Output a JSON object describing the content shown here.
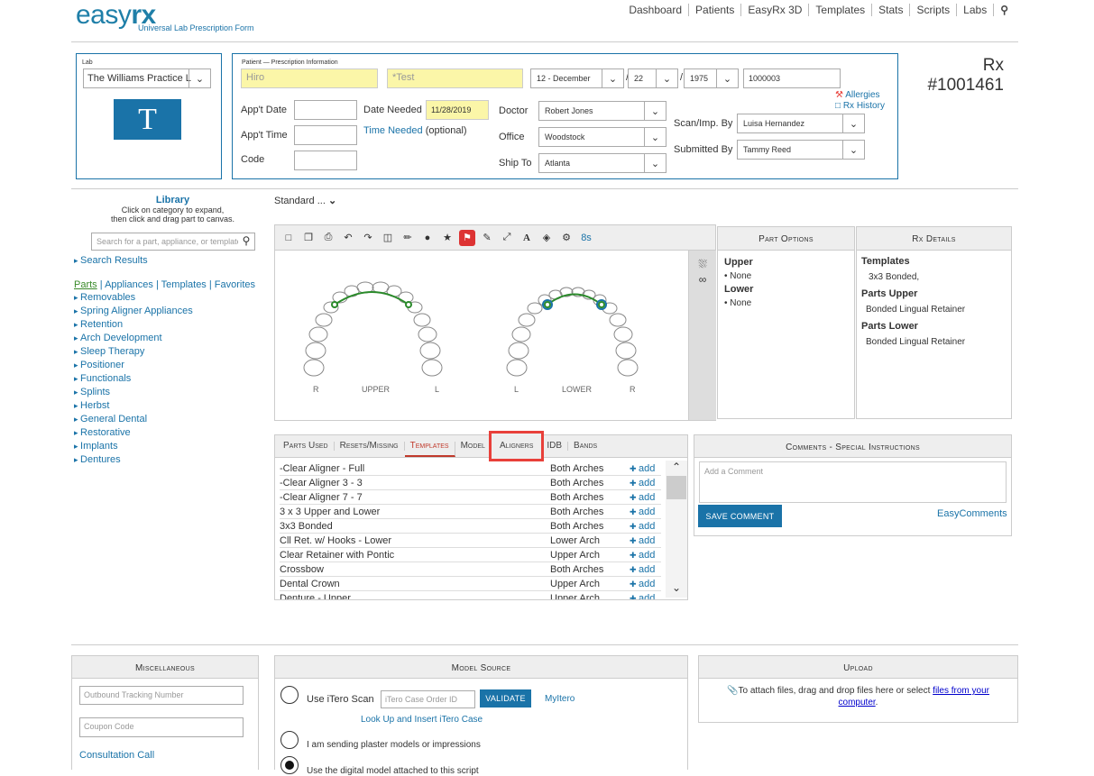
{
  "header": {
    "logo_main": "easyrx",
    "logo_sub": "Universal Lab Prescription Form",
    "nav": [
      "Dashboard",
      "Patients",
      "EasyRx 3D",
      "Templates",
      "Stats",
      "Scripts",
      "Labs"
    ],
    "rx_label": "Rx",
    "rx_number": "#1001461"
  },
  "lab": {
    "label": "Lab",
    "selected": "The Williams Practice L",
    "logo_letter": "T"
  },
  "patient": {
    "section_label": "Patient — Prescription Information",
    "first_name": "Hiro",
    "last_name": "*Test",
    "birth_month": "12 - December",
    "birth_day": "22",
    "birth_year": "1975",
    "patient_id": "1000003",
    "allergies": "Allergies",
    "rx_history": "Rx History",
    "appt_date_label": "App't Date",
    "appt_time_label": "App't Time",
    "code_label": "Code",
    "date_needed_label": "Date Needed",
    "date_needed_value": "11/28/2019",
    "time_needed_label": "Time Needed",
    "time_needed_optional": "(optional)",
    "doctor_label": "Doctor",
    "doctor": "Robert Jones",
    "office_label": "Office",
    "office": "Woodstock",
    "ship_to_label": "Ship To",
    "ship_to": "Atlanta",
    "scan_by_label": "Scan/Imp. By",
    "scan_by": "Luisa Hernandez",
    "submitted_by_label": "Submitted By",
    "submitted_by": "Tammy Reed"
  },
  "library": {
    "title": "Library",
    "hint1": "Click on category to expand,",
    "hint2": "then click and drag part to canvas.",
    "search_placeholder": "Search for a part, appliance, or template",
    "search_results": "Search Results",
    "tabs": [
      "Parts",
      "Appliances",
      "Templates",
      "Favorites"
    ],
    "categories": [
      "Removables",
      "Spring Aligner Appliances",
      "Retention",
      "Arch Development",
      "Sleep Therapy",
      "Positioner",
      "Functionals",
      "Splints",
      "Herbst",
      "General Dental",
      "Restorative",
      "Implants",
      "Dentures"
    ]
  },
  "canvas": {
    "standard_label": "Standard ...",
    "toolbar_timer": "8s",
    "upper_label": "UPPER",
    "lower_label": "LOWER",
    "upper_r": "R",
    "upper_l": "L",
    "lower_l": "L",
    "lower_r": "R"
  },
  "part_options": {
    "title": "Part Options",
    "upper": "Upper",
    "upper_value": "• None",
    "lower": "Lower",
    "lower_value": "• None"
  },
  "rx_details": {
    "title": "Rx Details",
    "templates_h": "Templates",
    "templates_v": "3x3 Bonded,",
    "upper_h": "Parts Upper",
    "upper_v": "Bonded Lingual Retainer",
    "lower_h": "Parts Lower",
    "lower_v": "Bonded Lingual Retainer"
  },
  "bottom_tabs": [
    "Parts Used",
    "Resets/Missing",
    "Templates",
    "Model",
    "Aligners",
    "IDB",
    "Bands"
  ],
  "templates_list": [
    {
      "name": "-Clear Aligner - Full",
      "arch": "Both Arches",
      "action": "add"
    },
    {
      "name": "-Clear Aligner 3 - 3",
      "arch": "Both Arches",
      "action": "add"
    },
    {
      "name": "-Clear Aligner 7 - 7",
      "arch": "Both Arches",
      "action": "add"
    },
    {
      "name": "3 x 3 Upper and Lower",
      "arch": "Both Arches",
      "action": "add"
    },
    {
      "name": "3x3 Bonded",
      "arch": "Both Arches",
      "action": "add"
    },
    {
      "name": "Cll Ret. w/ Hooks - Lower",
      "arch": "Lower Arch",
      "action": "add"
    },
    {
      "name": "Clear Retainer with Pontic",
      "arch": "Upper Arch",
      "action": "add"
    },
    {
      "name": "Crossbow",
      "arch": "Both Arches",
      "action": "add"
    },
    {
      "name": "Dental Crown",
      "arch": "Upper Arch",
      "action": "add"
    },
    {
      "name": "Denture - Upper",
      "arch": "Upper Arch",
      "action": "add"
    }
  ],
  "comments": {
    "title": "Comments - Special Instructions",
    "placeholder": "Add a Comment",
    "save": "SAVE COMMENT",
    "easy": "EasyComments"
  },
  "misc": {
    "title": "Miscellaneous",
    "tracking_placeholder": "Outbound Tracking Number",
    "coupon_placeholder": "Coupon Code",
    "consultation": "Consultation Call"
  },
  "model_source": {
    "title": "Model Source",
    "use_itero": "Use iTero Scan",
    "itero_placeholder": "iTero Case Order ID",
    "validate": "VALIDATE",
    "myitero": "MyItero",
    "lookup": "Look Up and Insert iTero Case",
    "plaster": "I am sending plaster models or impressions",
    "digital": "Use the digital model attached to this script"
  },
  "upload": {
    "title": "Upload",
    "text": "To attach files, drag and drop files here or select",
    "link": "files from your computer"
  },
  "colors": {
    "accent": "#1a73a8",
    "highlight": "#e8403a",
    "yellow": "#fbf6a8"
  }
}
